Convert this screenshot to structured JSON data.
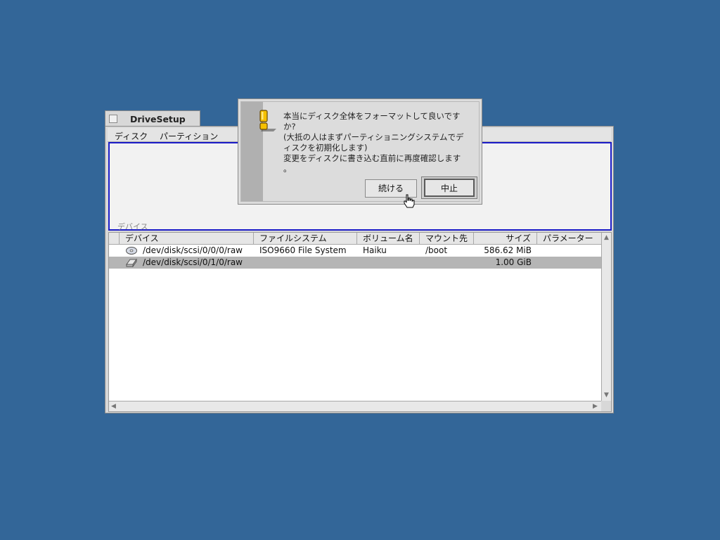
{
  "window": {
    "title": "DriveSetup",
    "menu": [
      "ディスク",
      "パーティション"
    ],
    "disk_map_label": "デバイス"
  },
  "table": {
    "columns": [
      "デバイス",
      "ファイルシステム",
      "ボリューム名",
      "マウント先",
      "サイズ",
      "パラメーター"
    ],
    "rows": [
      {
        "icon": "cd-disk-icon",
        "device": "/dev/disk/scsi/0/0/0/raw",
        "filesystem": "ISO9660 File System",
        "volume": "Haiku",
        "mount": "/boot",
        "size": "586.62 MiB",
        "params": "",
        "selected": false
      },
      {
        "icon": "hard-disk-icon",
        "device": "/dev/disk/scsi/0/1/0/raw",
        "filesystem": "",
        "volume": "",
        "mount": "",
        "size": "1.00 GiB",
        "params": "",
        "selected": true
      }
    ]
  },
  "alert": {
    "icon": "warning-icon",
    "lines": [
      "本当にディスク全体をフォーマットして良いです",
      "か?",
      "(大抵の人はまずパーティショニングシステムでデ",
      "ィスクを初期化します)",
      "変更をディスクに書き込む直前に再度確認します",
      "。"
    ],
    "continue_label": "続ける",
    "cancel_label": "中止"
  },
  "colors": {
    "desktop": "#336698",
    "focus_border": "#1c1cc8",
    "selection": "#b5b5b5"
  }
}
